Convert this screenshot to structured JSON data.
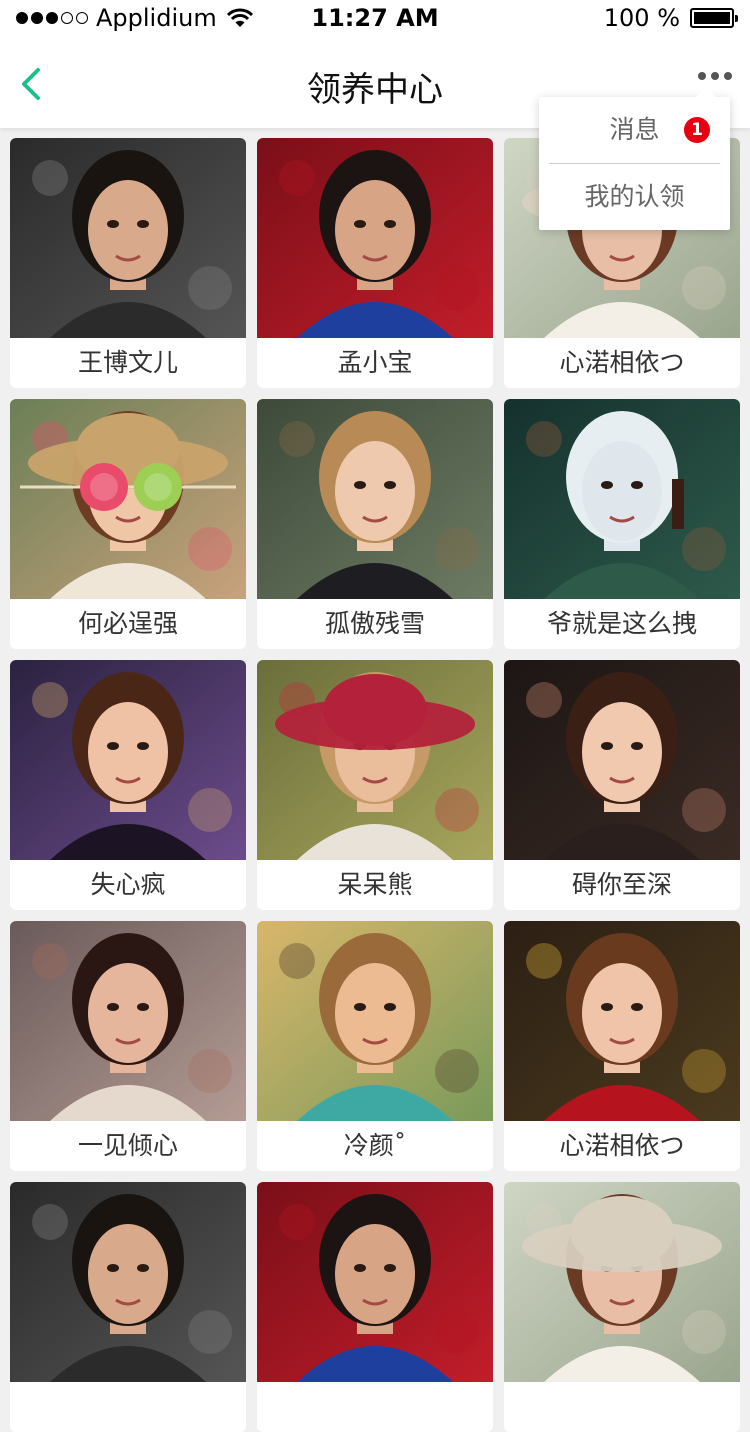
{
  "status_bar": {
    "carrier": "Applidium",
    "time": "11:27 AM",
    "battery": "100 %",
    "battery_level": 1.0
  },
  "nav": {
    "title": "领养中心",
    "back_icon": "chevron-left-icon",
    "more_icon": "more-dots-icon",
    "accent_color": "#1dbf8a"
  },
  "menu": {
    "items": [
      {
        "label": "消息",
        "badge": "1"
      },
      {
        "label": "我的认领"
      }
    ],
    "badge_color": "#e60012"
  },
  "cards": [
    {
      "name": "王博文儿",
      "photo": "man-dark-hair"
    },
    {
      "name": "孟小宝",
      "photo": "man-red-flowers"
    },
    {
      "name": "心渃相依つ",
      "photo": "woman-straw-hat"
    },
    {
      "name": "何必逞强",
      "photo": "girl-lollipops"
    },
    {
      "name": "孤傲残雪",
      "photo": "blonde-woman"
    },
    {
      "name": "爷就是这么拽",
      "photo": "white-mask"
    },
    {
      "name": "失心疯",
      "photo": "woman-bokeh"
    },
    {
      "name": "呆呆熊",
      "photo": "woman-red-beanie"
    },
    {
      "name": "碍你至深",
      "photo": "girl-bangs-braids"
    },
    {
      "name": "一见倾心",
      "photo": "woman-short-hair"
    },
    {
      "name": "冷颜˚",
      "photo": "boy-slingshot"
    },
    {
      "name": "心渃相依つ",
      "photo": "woman-red-dress-crown"
    },
    {
      "name": "",
      "photo": "man-dark-hair"
    },
    {
      "name": "",
      "photo": "man-red-flowers"
    },
    {
      "name": "",
      "photo": "woman-straw-hat"
    }
  ]
}
